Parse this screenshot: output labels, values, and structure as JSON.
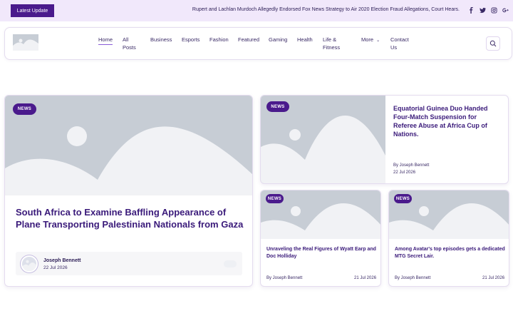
{
  "topbar": {
    "latest_label": "Latest Update",
    "ticker_text": "Rupert and Lachlan Murdoch Allegedly Endorsed Fox News Strategy to Air 2020 Election Fraud Allegations, Court Hears.",
    "socials": [
      "facebook-icon",
      "twitter-icon",
      "instagram-icon",
      "google-plus-icon"
    ]
  },
  "nav": {
    "home": "Home",
    "all_posts_1": "All",
    "all_posts_2": "Posts",
    "business": "Business",
    "esports": "Esports",
    "fashion": "Fashion",
    "featured": "Featured",
    "gaming": "Gaming",
    "health": "Health",
    "life_1": "Life &",
    "life_2": "Fitness",
    "more": "More",
    "contact_1": "Contact",
    "contact_2": "Us"
  },
  "featured": {
    "badge": "NEWS",
    "title": "South Africa to Examine Baffling Appearance of Plane Transporting Palestinian Nationals from Gaza",
    "author": "Joseph Bennett",
    "date": "22 Jul 2026"
  },
  "side_top": {
    "badge": "NEWS",
    "title": "Equatorial Guinea Duo Handed Four-Match Suspension for Referee Abuse at Africa Cup of Nations.",
    "author": "By Joseph Bennett",
    "date": "22 Jul 2026"
  },
  "small_cards": [
    {
      "badge": "NEWS",
      "title": "Unraveling the Real Figures of Wyatt Earp and Doc Holliday",
      "author": "By Joseph Bennett",
      "date": "21 Jul 2026"
    },
    {
      "badge": "NEWS",
      "title": "Among Avatar's top episodes gets a dedicated MTG Secret Lair.",
      "author": "By Joseph Bennett",
      "date": "21 Jul 2026"
    }
  ],
  "colors": {
    "accent": "#4a1a8c",
    "topbar_bg": "#f1e8fb",
    "placeholder": "#c7cdd5"
  }
}
